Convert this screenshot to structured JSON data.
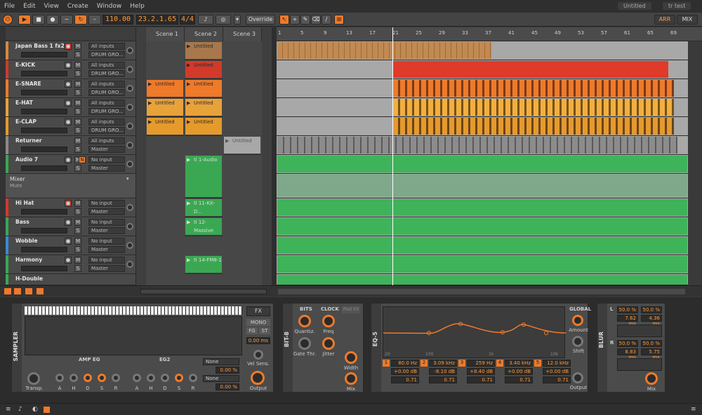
{
  "menu": [
    "File",
    "Edit",
    "View",
    "Create",
    "Window",
    "Help"
  ],
  "doc_tabs": [
    "Untitled",
    "tr test"
  ],
  "transport": {
    "tempo": "110.00",
    "position": "23.2.1.65",
    "signature": "4/4",
    "override": "Override",
    "arr": "ARR",
    "mix": "MIX"
  },
  "scenes": [
    "Scene 1",
    "Scene 2",
    "Scene 3"
  ],
  "ruler": [
    "1",
    "5",
    "9",
    "13",
    "17",
    "21",
    "25",
    "29",
    "33",
    "37",
    "41",
    "45",
    "49",
    "53",
    "57",
    "61",
    "65",
    "69"
  ],
  "tracks": [
    {
      "name": "Japan Bass 1 fx2",
      "color": "#d38b3d",
      "input": "All inputs",
      "output": "DRUM GRO..."
    },
    {
      "name": "E-KICK",
      "color": "#d23a2a",
      "input": "All inputs",
      "output": "DRUM GRO..."
    },
    {
      "name": "E-SNARE",
      "color": "#ee7a2a",
      "input": "All inputs",
      "output": "DRUM GRO..."
    },
    {
      "name": "E-HAT",
      "color": "#e8a23a",
      "input": "All inputs",
      "output": "DRUM GRO..."
    },
    {
      "name": "E-CLAP",
      "color": "#e59a2c",
      "input": "All inputs",
      "output": "DRUM GRO..."
    },
    {
      "name": "Returner",
      "color": "#8a8a8a",
      "input": "All inputs",
      "output": "Master"
    },
    {
      "name": "Audio 7",
      "color": "#3aa852",
      "input": "No input",
      "output": "Master"
    },
    {
      "name": "Hi Hat",
      "color": "#d23a2a",
      "input": "No input",
      "output": "Master"
    },
    {
      "name": "Bass",
      "color": "#3aa852",
      "input": "No input",
      "output": "Master"
    },
    {
      "name": "Wobble",
      "color": "#3a8ad0",
      "input": "No input",
      "output": "Master"
    },
    {
      "name": "Harmony",
      "color": "#3aa852",
      "input": "No input",
      "output": "Master"
    },
    {
      "name": "H-Double",
      "color": "#3aa852",
      "input": "No input",
      "output": "Master"
    }
  ],
  "mixer_row": {
    "label": "Mixer",
    "sub": "Mute"
  },
  "clips": {
    "japan_s2": "Untitled",
    "kick_s2": "Untitled",
    "snare_s1": "Untitled",
    "snare_s2": "Untitled",
    "hat_s1": "Untitled",
    "hat_s2": "Untitled",
    "clap_s1": "Untitled",
    "clap_s2": "Untitled",
    "returner_s3": "Untitled",
    "audio7_s2": "tl 1-Audio",
    "hihat_s2": "tl 11-Kit-D...",
    "bass_s2": "tl 12-Massive",
    "harmony_s2": "tl 14-FM8-1"
  },
  "devices": {
    "sampler": {
      "title": "SAMPLER",
      "ampeg": "AMP EG",
      "eg2": "EG2",
      "knobs": [
        "Transp.",
        "A",
        "H",
        "D",
        "S",
        "R",
        "A",
        "H",
        "D",
        "S",
        "R"
      ],
      "fx": "FX",
      "mono": "MONO",
      "fg": "FG",
      "st": "ST",
      "time": "0.00 ms",
      "vel": "Vel Sens.",
      "output": "Output",
      "none1": "None",
      "none2": "None",
      "pct1": "0.00 %",
      "pct2": "0.00 %"
    },
    "bit8": {
      "title": "BIT-8",
      "bits": "BITS",
      "clock": "CLOCK",
      "knobs": [
        "Quantiz.",
        "Freq",
        "Gate Thr.",
        "Jitter",
        "Width",
        "Mix"
      ],
      "postfx": "Post FX"
    },
    "eq5": {
      "title": "EQ-5",
      "axis": [
        "20",
        "100",
        "1k",
        "10k"
      ],
      "bands": [
        {
          "n": "1",
          "freq": "80.0 Hz",
          "gain": "+0.00 dB",
          "q": "0.71"
        },
        {
          "n": "2",
          "freq": "3.09 kHz",
          "gain": "-8.10 dB",
          "q": "0.71"
        },
        {
          "n": "3",
          "freq": "259 Hz",
          "gain": "+8.40 dB",
          "q": "0.71"
        },
        {
          "n": "4",
          "freq": "3.40 kHz",
          "gain": "+0.00 dB",
          "q": "0.71"
        },
        {
          "n": "5",
          "freq": "12.0 kHz",
          "gain": "+0.00 dB",
          "q": "0.71"
        }
      ],
      "global": "GLOBAL",
      "amount": "Amount",
      "shift": "Shift",
      "output": "Output"
    },
    "blur": {
      "title": "BLUR",
      "l": "L",
      "r": "R",
      "l_vals": [
        "50.0 %",
        "50.0 %",
        "7.62 ms",
        "4.36 ms"
      ],
      "r_vals": [
        "50.0 %",
        "50.0 %",
        "8.83 ms",
        "5.75 ms"
      ],
      "mix": "Mix"
    }
  }
}
